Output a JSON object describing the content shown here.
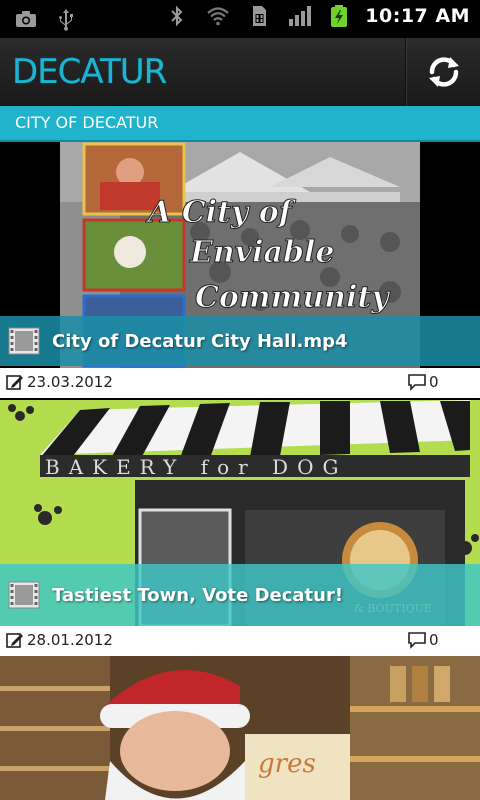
{
  "status_bar": {
    "time": "10:17 AM",
    "icons": [
      "camera-icon",
      "usb-icon",
      "bluetooth-icon",
      "wifi-icon",
      "sim-icon",
      "signal-icon",
      "battery-charging-icon"
    ]
  },
  "header": {
    "logo_text": "DECATUR",
    "refresh_icon": "refresh-icon"
  },
  "section": {
    "title": "CITY OF DECATUR"
  },
  "videos": [
    {
      "title": "City of Decatur City Hall.mp4",
      "thumbnail_text": "A City of Enviable Community",
      "date": "23.03.2012",
      "comments": "0"
    },
    {
      "title": "Tastiest Town, Vote Decatur!",
      "thumbnail_text": "BAKERY for DOG",
      "date": "28.01.2012",
      "comments": "0"
    },
    {
      "title": "",
      "thumbnail_text": "",
      "date": "",
      "comments": ""
    }
  ],
  "colors": {
    "accent": "#20b3cc",
    "logo": "#1bb4d1",
    "header_bg": "#222222",
    "caption_overlay_1": "#1b8ea6",
    "caption_overlay_2": "#3ec7c7"
  }
}
